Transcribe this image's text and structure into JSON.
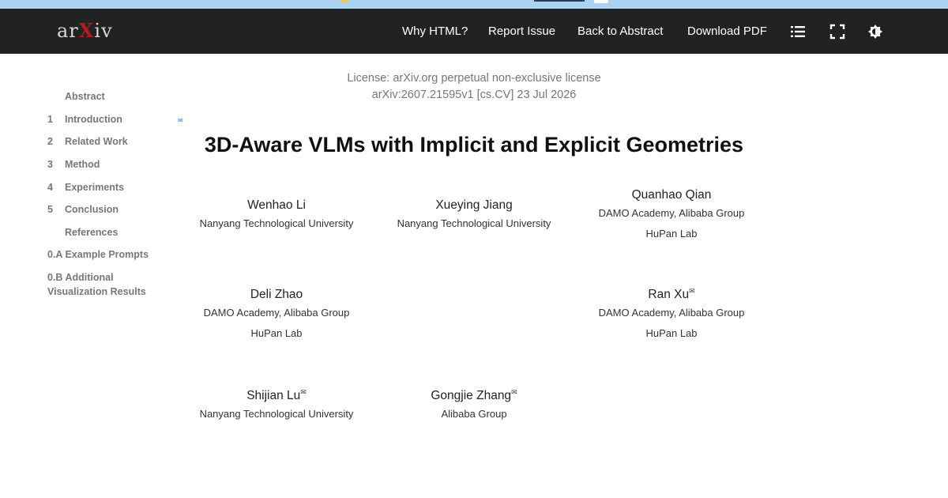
{
  "header": {
    "logo_text": "arXiv",
    "nav": [
      {
        "label": "Why HTML?"
      },
      {
        "label": "Report Issue"
      },
      {
        "label": "Back to Abstract"
      },
      {
        "label": "Download PDF"
      }
    ],
    "icons": [
      "toc-list-icon",
      "fullscreen-icon",
      "theme-settings-icon"
    ]
  },
  "toc": {
    "items": [
      {
        "num": "",
        "label": "Abstract"
      },
      {
        "num": "1",
        "label": "Introduction"
      },
      {
        "num": "2",
        "label": "Related Work"
      },
      {
        "num": "3",
        "label": "Method"
      },
      {
        "num": "4",
        "label": "Experiments"
      },
      {
        "num": "5",
        "label": "Conclusion"
      },
      {
        "num": "",
        "label": "References"
      },
      {
        "num": "",
        "label": "0.A Example Prompts"
      },
      {
        "num": "",
        "label": "0.B Additional Visualization Results"
      }
    ]
  },
  "paper": {
    "license": "License: arXiv.org perpetual non-exclusive license",
    "id_line": "arXiv:2607.21595v1 [cs.CV] 23 Jul 2026",
    "title": "3D-Aware VLMs with Implicit and Explicit Geometries",
    "authors": [
      {
        "name": "Wenhao Li",
        "mark": "",
        "affiliations": [
          "Nanyang Technological University"
        ]
      },
      {
        "name": "Xueying Jiang",
        "mark": "",
        "affiliations": [
          "Nanyang Technological University"
        ]
      },
      {
        "name": "Quanhao Qian",
        "mark": "",
        "affiliations": [
          "DAMO Academy, Alibaba Group",
          "HuPan Lab"
        ]
      },
      {
        "name": "Deli Zhao",
        "mark": "",
        "affiliations": [
          "DAMO Academy, Alibaba Group",
          "HuPan Lab"
        ]
      },
      {
        "name": "Ran Xu",
        "mark": "✉",
        "affiliations": [
          "DAMO Academy, Alibaba Group",
          "HuPan Lab"
        ]
      },
      {
        "name": "Shijian Lu",
        "mark": "✉",
        "affiliations": [
          "Nanyang Technological University"
        ]
      },
      {
        "name": "Gongjie Zhang",
        "mark": "✉",
        "affiliations": [
          "Alibaba Group"
        ]
      }
    ]
  },
  "colors": {
    "header_bg": "#222222",
    "top_strip": "#aad3f2",
    "logo_x": "#b31b1b"
  }
}
